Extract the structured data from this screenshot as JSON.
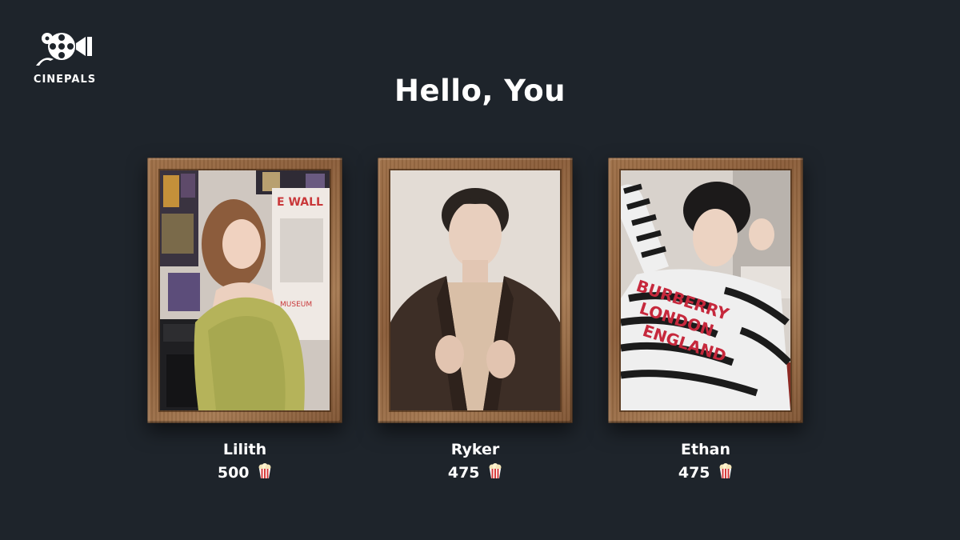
{
  "brand": {
    "name": "CINEPALS",
    "logo_icon": "film-camera-icon"
  },
  "greeting": "Hello, You",
  "profiles": [
    {
      "name": "Lilith",
      "points": "500",
      "currency_icon": "popcorn-icon"
    },
    {
      "name": "Ryker",
      "points": "475",
      "currency_icon": "popcorn-icon"
    },
    {
      "name": "Ethan",
      "points": "475",
      "currency_icon": "popcorn-icon"
    }
  ],
  "colors": {
    "background": "#1e242b",
    "frame_wood": "#8a5c38",
    "text": "#ffffff",
    "popcorn_red": "#d63a3a"
  }
}
